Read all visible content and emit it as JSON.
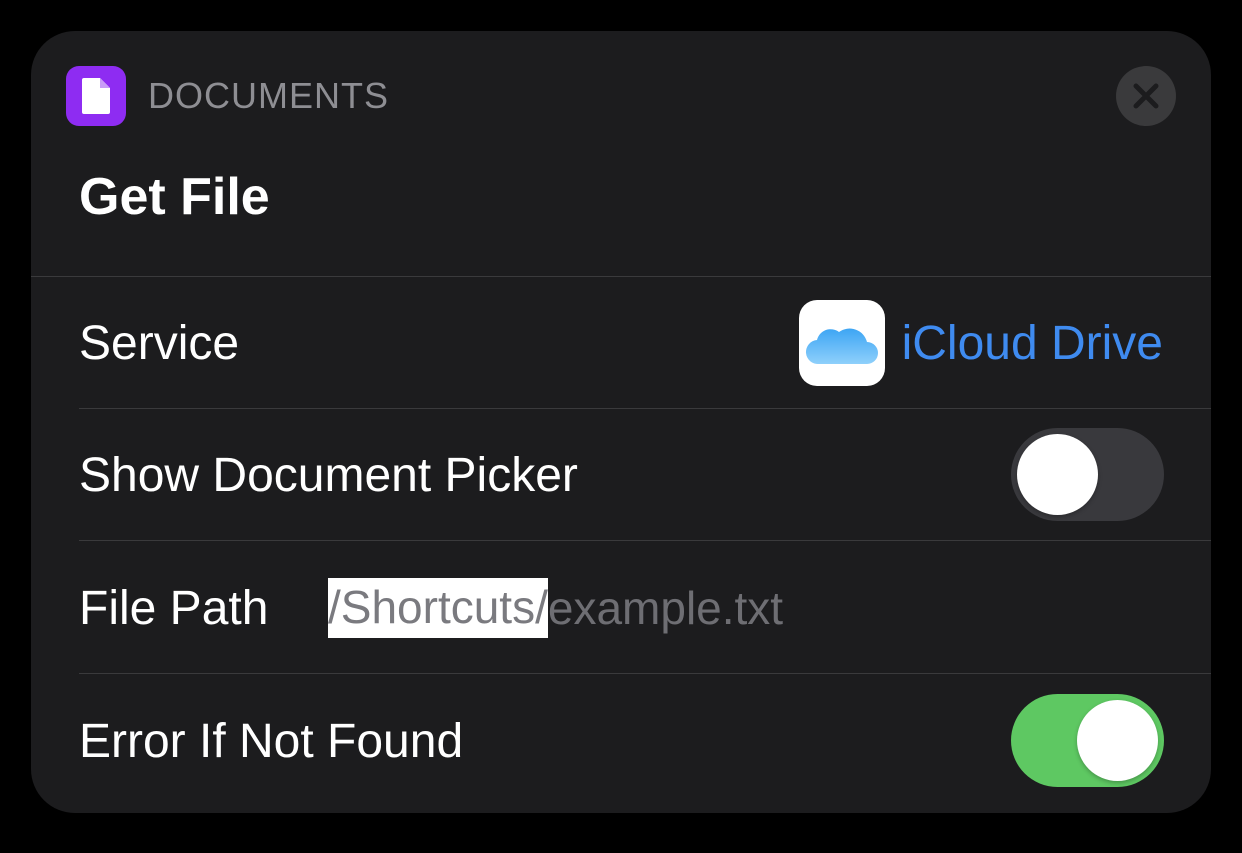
{
  "header": {
    "category": "DOCUMENTS",
    "icon": "document-icon",
    "icon_color": "#8e2cf2",
    "close_icon": "close-icon"
  },
  "title": "Get File",
  "rows": {
    "service": {
      "label": "Service",
      "value": "iCloud Drive",
      "icon": "icloud-icon",
      "value_color": "#3f8bf0"
    },
    "show_picker": {
      "label": "Show Document Picker",
      "enabled": false
    },
    "file_path": {
      "label": "File Path",
      "selected_text": "/Shortcuts/",
      "placeholder_text": "example.txt"
    },
    "error_if_not_found": {
      "label": "Error If Not Found",
      "enabled": true,
      "on_color": "#5ec862"
    }
  }
}
